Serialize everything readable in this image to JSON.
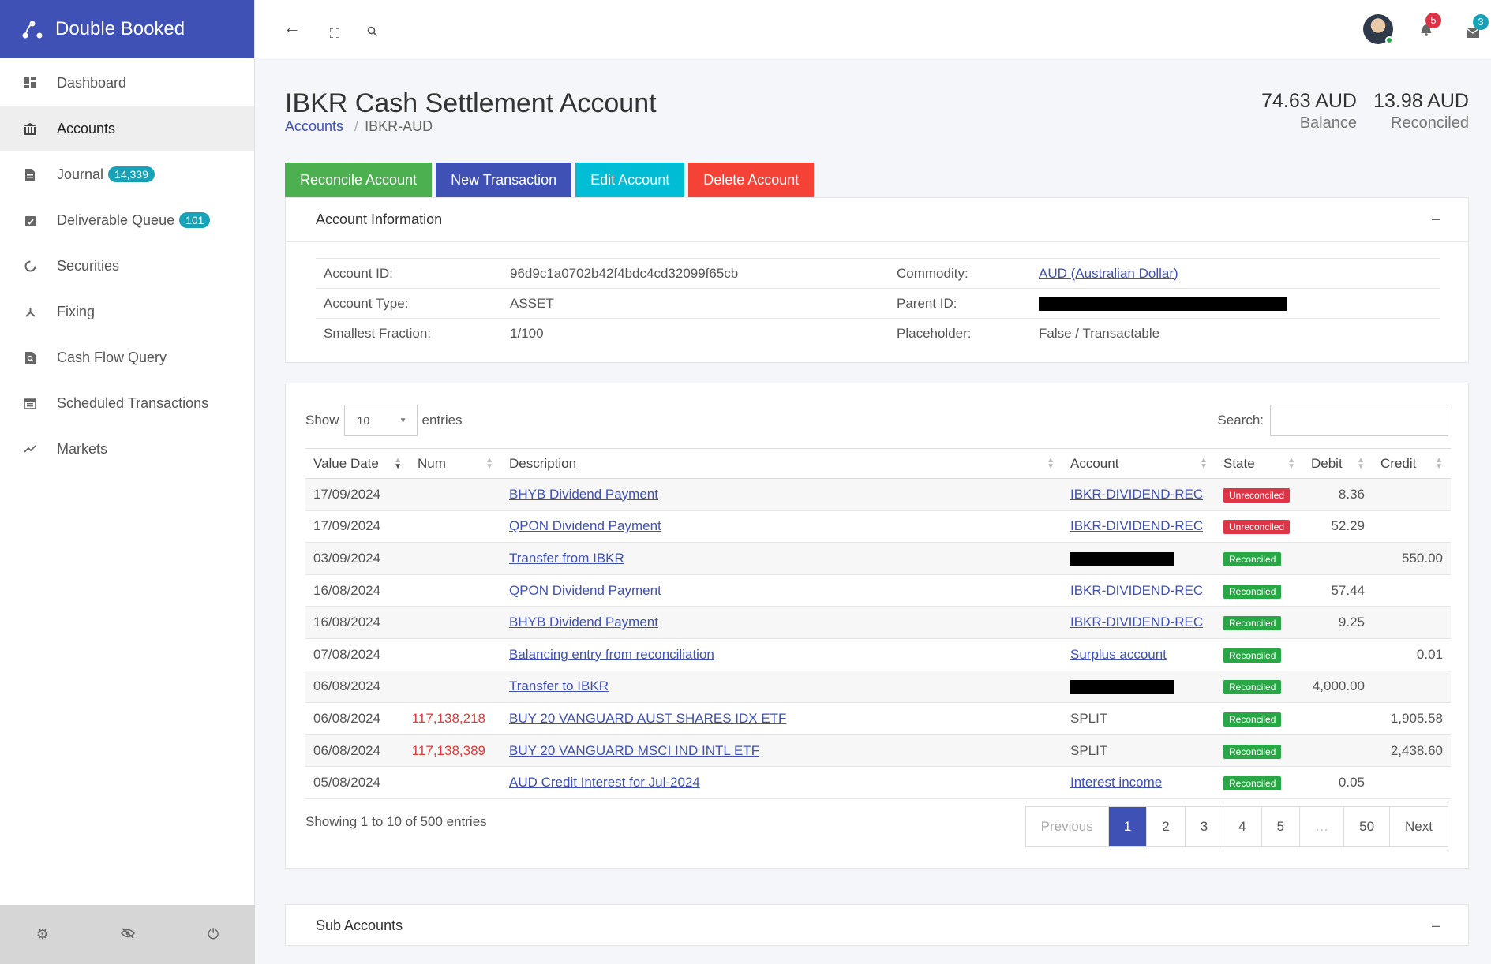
{
  "app": {
    "name": "Double Booked"
  },
  "sidebar": {
    "items": [
      {
        "label": "Dashboard",
        "icon": "dashboard-icon"
      },
      {
        "label": "Accounts",
        "icon": "bank-icon"
      },
      {
        "label": "Journal",
        "icon": "document-icon",
        "badge": "14,339"
      },
      {
        "label": "Deliverable Queue",
        "icon": "clipboard-check-icon",
        "badge": "101"
      },
      {
        "label": "Securities",
        "icon": "circle-notch-icon"
      },
      {
        "label": "Fixing",
        "icon": "fork-icon"
      },
      {
        "label": "Cash Flow Query",
        "icon": "file-search-icon"
      },
      {
        "label": "Scheduled Transactions",
        "icon": "calendar-icon"
      },
      {
        "label": "Markets",
        "icon": "trend-icon"
      }
    ],
    "active_index": 1
  },
  "topbar": {
    "notifications_count": "5",
    "messages_count": "3"
  },
  "page": {
    "title": "IBKR Cash Settlement Account",
    "breadcrumb": {
      "parent": "Accounts",
      "current": "IBKR-AUD"
    },
    "balance": {
      "value": "74.63 AUD",
      "label": "Balance"
    },
    "reconciled": {
      "value": "13.98 AUD",
      "label": "Reconciled"
    }
  },
  "actions": {
    "reconcile": "Reconcile Account",
    "new_transaction": "New Transaction",
    "edit": "Edit Account",
    "delete": "Delete Account"
  },
  "account_info": {
    "heading": "Account Information",
    "collapse": "–",
    "rows": [
      {
        "l1": "Account ID:",
        "v1": "96d9c1a0702b42f4bdc4cd32099f65cb",
        "l2": "Commodity:",
        "v2": "AUD (Australian Dollar)"
      },
      {
        "l1": "Account Type:",
        "v1": "ASSET",
        "l2": "Parent ID:",
        "v2": ""
      },
      {
        "l1": "Smallest Fraction:",
        "v1": "1/100",
        "l2": "Placeholder:",
        "v2": "False / Transactable"
      }
    ]
  },
  "table": {
    "show_label": "Show",
    "page_size": "10",
    "entries_label": "entries",
    "search_label": "Search:",
    "columns": [
      "Value Date",
      "Num",
      "Description",
      "Account",
      "State",
      "Debit",
      "Credit"
    ],
    "rows": [
      {
        "date": "17/09/2024",
        "num": "",
        "desc": "BHYB Dividend Payment",
        "account": "IBKR-DIVIDEND-REC",
        "state": "Unreconciled",
        "debit": "8.36",
        "credit": ""
      },
      {
        "date": "17/09/2024",
        "num": "",
        "desc": "QPON Dividend Payment",
        "account": "IBKR-DIVIDEND-REC",
        "state": "Unreconciled",
        "debit": "52.29",
        "credit": ""
      },
      {
        "date": "03/09/2024",
        "num": "",
        "desc": "Transfer from IBKR",
        "account": "",
        "state": "Reconciled",
        "debit": "",
        "credit": "550.00"
      },
      {
        "date": "16/08/2024",
        "num": "",
        "desc": "QPON Dividend Payment",
        "account": "IBKR-DIVIDEND-REC",
        "state": "Reconciled",
        "debit": "57.44",
        "credit": ""
      },
      {
        "date": "16/08/2024",
        "num": "",
        "desc": "BHYB Dividend Payment",
        "account": "IBKR-DIVIDEND-REC",
        "state": "Reconciled",
        "debit": "9.25",
        "credit": ""
      },
      {
        "date": "07/08/2024",
        "num": "",
        "desc": "Balancing entry from reconciliation",
        "account": "Surplus account",
        "state": "Reconciled",
        "debit": "",
        "credit": "0.01"
      },
      {
        "date": "06/08/2024",
        "num": "",
        "desc": "Transfer to IBKR",
        "account": "",
        "state": "Reconciled",
        "debit": "4,000.00",
        "credit": ""
      },
      {
        "date": "06/08/2024",
        "num": "117,138,218",
        "desc": "BUY 20 VANGUARD AUST SHARES IDX ETF",
        "account": "SPLIT",
        "state": "Reconciled",
        "debit": "",
        "credit": "1,905.58"
      },
      {
        "date": "06/08/2024",
        "num": "117,138,389",
        "desc": "BUY 20 VANGUARD MSCI IND INTL ETF",
        "account": "SPLIT",
        "state": "Reconciled",
        "debit": "",
        "credit": "2,438.60"
      },
      {
        "date": "05/08/2024",
        "num": "",
        "desc": "AUD Credit Interest for Jul-2024",
        "account": "Interest income",
        "state": "Reconciled",
        "debit": "0.05",
        "credit": ""
      }
    ],
    "showing": "Showing 1 to 10 of 500 entries",
    "pager": [
      "Previous",
      "1",
      "2",
      "3",
      "4",
      "5",
      "…",
      "50",
      "Next"
    ]
  },
  "sub_accounts": {
    "heading": "Sub Accounts",
    "collapse": "–"
  }
}
